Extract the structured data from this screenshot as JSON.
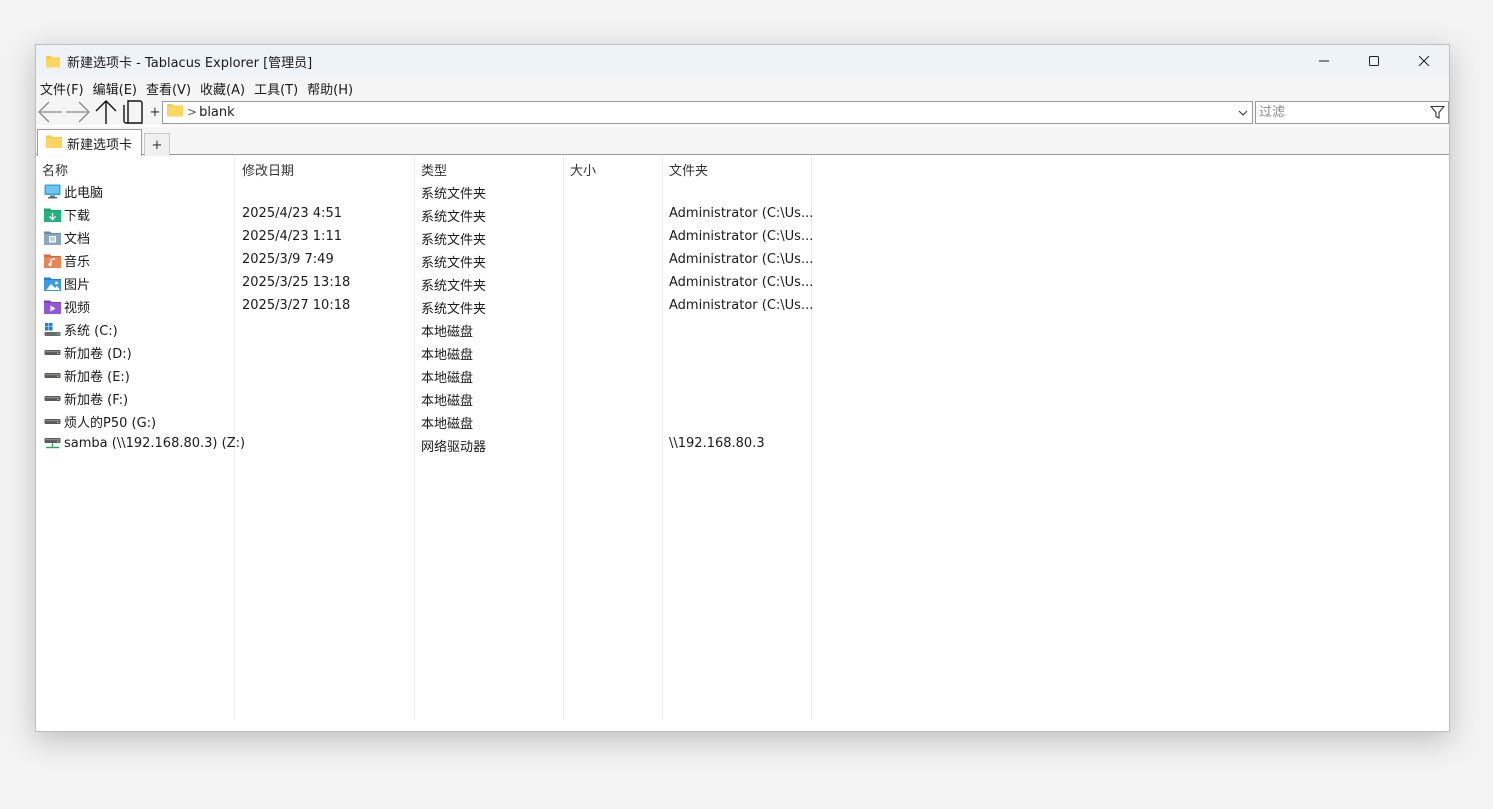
{
  "window": {
    "title": "新建选项卡 - Tablacus Explorer [管理员]"
  },
  "menu": [
    {
      "label": "文件(F)"
    },
    {
      "label": "编辑(E)"
    },
    {
      "label": "查看(V)"
    },
    {
      "label": "收藏(A)"
    },
    {
      "label": "工具(T)"
    },
    {
      "label": "帮助(H)"
    }
  ],
  "toolbar": {
    "new_tab_symbol": "+",
    "address_separator": ">",
    "address_path": "blank",
    "filter_placeholder": "过滤"
  },
  "tabs": [
    {
      "label": "新建选项卡",
      "active": true
    }
  ],
  "tab_add_label": "+",
  "columns": [
    {
      "label": "名称"
    },
    {
      "label": "修改日期"
    },
    {
      "label": "类型"
    },
    {
      "label": "大小"
    },
    {
      "label": "文件夹"
    }
  ],
  "rows": [
    {
      "icon": "this-pc-icon",
      "name": "此电脑",
      "modified": "",
      "type": "系统文件夹",
      "size": "",
      "folder": ""
    },
    {
      "icon": "downloads-folder-icon",
      "name": "下载",
      "modified": "2025/4/23 4:51",
      "type": "系统文件夹",
      "size": "",
      "folder": "Administrator (C:\\Us..."
    },
    {
      "icon": "documents-folder-icon",
      "name": "文档",
      "modified": "2025/4/23 1:11",
      "type": "系统文件夹",
      "size": "",
      "folder": "Administrator (C:\\Us..."
    },
    {
      "icon": "music-folder-icon",
      "name": "音乐",
      "modified": "2025/3/9 7:49",
      "type": "系统文件夹",
      "size": "",
      "folder": "Administrator (C:\\Us..."
    },
    {
      "icon": "pictures-folder-icon",
      "name": "图片",
      "modified": "2025/3/25 13:18",
      "type": "系统文件夹",
      "size": "",
      "folder": "Administrator (C:\\Us..."
    },
    {
      "icon": "videos-folder-icon",
      "name": "视频",
      "modified": "2025/3/27 10:18",
      "type": "系统文件夹",
      "size": "",
      "folder": "Administrator (C:\\Us..."
    },
    {
      "icon": "system-drive-icon",
      "name": "系统 (C:)",
      "modified": "",
      "type": "本地磁盘",
      "size": "",
      "folder": ""
    },
    {
      "icon": "drive-icon",
      "name": "新加卷 (D:)",
      "modified": "",
      "type": "本地磁盘",
      "size": "",
      "folder": ""
    },
    {
      "icon": "drive-icon",
      "name": "新加卷 (E:)",
      "modified": "",
      "type": "本地磁盘",
      "size": "",
      "folder": ""
    },
    {
      "icon": "drive-icon",
      "name": "新加卷 (F:)",
      "modified": "",
      "type": "本地磁盘",
      "size": "",
      "folder": ""
    },
    {
      "icon": "drive-icon",
      "name": "烦人的P50 (G:)",
      "modified": "",
      "type": "本地磁盘",
      "size": "",
      "folder": ""
    },
    {
      "icon": "network-drive-icon",
      "name": "samba (\\\\192.168.80.3) (Z:)",
      "modified": "",
      "type": "网络驱动器",
      "size": "",
      "folder": "\\\\192.168.80.3"
    }
  ],
  "colors": {
    "titlebar_bg": "#eef3f8",
    "toolbar_bg": "#f5f5f5",
    "folder_yellow": "#f7c948",
    "accent_blue": "#1f7fd6"
  }
}
